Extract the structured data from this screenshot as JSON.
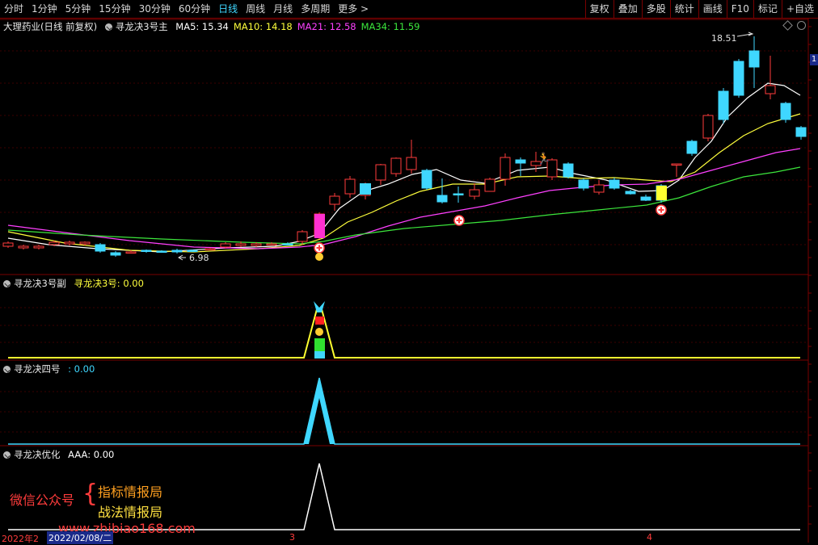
{
  "toolbar": {
    "periods": [
      "分时",
      "1分钟",
      "5分钟",
      "15分钟",
      "30分钟",
      "60分钟",
      "日线",
      "周线",
      "月线",
      "多周期",
      "更多"
    ],
    "active_period": "日线",
    "more_arrow": ">",
    "right_buttons": [
      "复权",
      "叠加",
      "多股",
      "统计",
      "画线",
      "F10",
      "标记",
      "+自选"
    ]
  },
  "main_panel": {
    "stock_title": "大理药业(日线 前复权)",
    "indicator_name": "寻龙决3号主",
    "ma": [
      {
        "label": "MA5: 15.34",
        "color": "#ffffff"
      },
      {
        "label": "MA10: 14.18",
        "color": "#ffff3c"
      },
      {
        "label": "MA21: 12.58",
        "color": "#ff40ff"
      },
      {
        "label": "MA34: 11.59",
        "color": "#3ce63c"
      }
    ],
    "high_label": "18.51",
    "low_label": "6.98",
    "right_tag": "1"
  },
  "sub1": {
    "name": "寻龙决3号副",
    "value_label": "寻龙决3号: 0.00",
    "value_color": "#ffff3c"
  },
  "sub2": {
    "name": "寻龙决四号",
    "value_label": ": 0.00",
    "value_color": "#3fd7ff"
  },
  "sub3": {
    "name": "寻龙决优化",
    "value_label": "AAA: 0.00",
    "value_color": "#ffffff"
  },
  "watermark": {
    "left": "微信公众号",
    "line1": "指标情报局",
    "line2": "战法情报局",
    "site": "www.zhibiao168.com"
  },
  "x_axis": {
    "start": "2022年2",
    "cursor": "2022/02/08/二",
    "m3": "3",
    "m4": "4"
  },
  "colors": {
    "up": "#ff3c3c",
    "down": "#3fd7ff",
    "grid": "#7a0000",
    "ma5": "#ffffff",
    "ma10": "#ffff3c",
    "ma21": "#ff40ff",
    "ma34": "#3ce63c"
  }
}
